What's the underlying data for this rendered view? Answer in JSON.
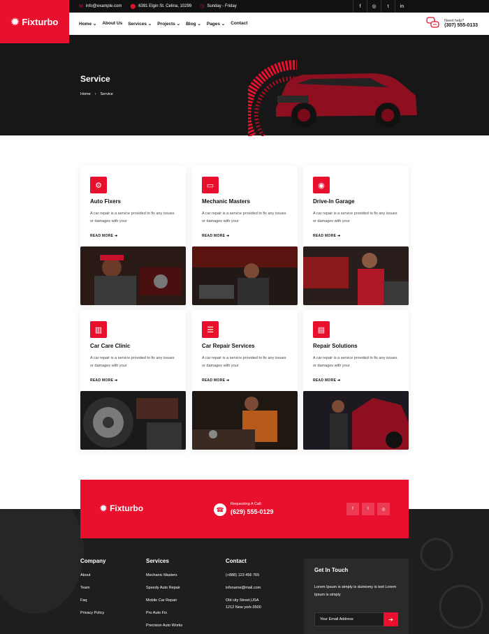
{
  "brand": {
    "name": "Fixturbo",
    "accent": "#e8102d"
  },
  "topbar": {
    "email": "info@example.com",
    "address": "6391 Elgin St. Celina, 10299",
    "hours": "Sunday - Friday",
    "socials": [
      "facebook-icon",
      "instagram-icon",
      "twitter-icon",
      "linkedin-icon"
    ],
    "social_glyphs": [
      "f",
      "◎",
      "t",
      "in"
    ]
  },
  "nav": {
    "items": [
      "Home ⌄",
      "About Us",
      "Services ⌄",
      "Projects ⌄",
      "Blog ⌄",
      "Pages ⌄",
      "Contact"
    ],
    "help_label": "Need help?",
    "help_phone": "(307) 555-0133"
  },
  "hero": {
    "title": "Service",
    "breadcrumb": [
      "Home",
      "›",
      "Service"
    ]
  },
  "cards": [
    {
      "title": "Auto Fixers",
      "desc": "A car repair is a service provided to fix any issues or damages with your",
      "cta": "READ MORE ➔",
      "icon": "engine-icon",
      "glyph": "⚙"
    },
    {
      "title": "Mechanic Masters",
      "desc": "A car repair is a service provided to fix any issues or damages with your",
      "cta": "READ MORE ➔",
      "icon": "car-screen-icon",
      "glyph": "▭"
    },
    {
      "title": "Drive-In Garage",
      "desc": "A car repair is a service provided to fix any issues or damages with your",
      "cta": "READ MORE ➔",
      "icon": "horn-icon",
      "glyph": "◉"
    },
    {
      "title": "Car Care Clinic",
      "desc": "A car repair is a service provided to fix any issues or damages with your",
      "cta": "READ MORE ➔",
      "icon": "toolbox-icon",
      "glyph": "▥"
    },
    {
      "title": "Car Repair Services",
      "desc": "A car repair is a service provided to fix any issues or damages with your",
      "cta": "READ MORE ➔",
      "icon": "checklist-icon",
      "glyph": "☰"
    },
    {
      "title": "Repair Solutions",
      "desc": "A car repair is a service provided to fix any issues or damages with your",
      "cta": "READ MORE ➔",
      "icon": "battery-icon",
      "glyph": "▤"
    }
  ],
  "cta": {
    "brand": "Fixturbo",
    "phone_label": "Requesting A Call:",
    "phone": "(629) 555-0129",
    "socials": [
      "facebook-icon",
      "twitter-icon",
      "instagram-icon"
    ],
    "social_glyphs": [
      "f",
      "t",
      "◎"
    ]
  },
  "footer": {
    "company": {
      "title": "Company",
      "items": [
        "About",
        "Team",
        "Faq",
        "Privacy Policy"
      ]
    },
    "services": {
      "title": "Services",
      "items": [
        "Mechanic Masters",
        "Speedy Auto Repair",
        "Mobile Car Repair",
        "Pro Auto Fix",
        "Precision Auto Works"
      ]
    },
    "contact": {
      "title": "Contact",
      "items": [
        "(+888) 123 456 765",
        "infoname@mail.com",
        "Old city Street,USA",
        "1212 New york-3500"
      ]
    },
    "newsletter": {
      "title": "Get In Touch",
      "text": "Lorem Ipsum is simply is dumiomy is text Lorem Ipsum is simply",
      "placeholder": "Your Email Address"
    }
  }
}
